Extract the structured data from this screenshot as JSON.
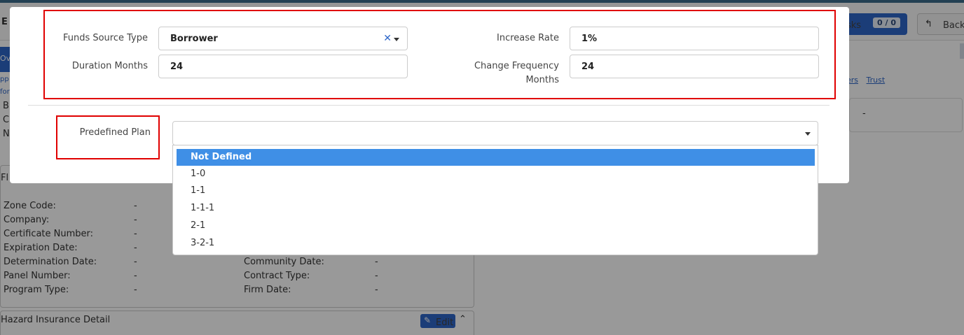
{
  "background": {
    "header_letter": "E",
    "tasks_label": "sks",
    "tasks_count": "0 / 0",
    "back_label": "Back",
    "left_tab_label": "Ov",
    "left_fragment_lines": [
      "B",
      "C",
      "N"
    ],
    "left_link_1": "pp",
    "left_link_2": "for",
    "links": [
      "ers",
      "Trust"
    ],
    "right_card_value": "-",
    "flood_title": "Fl",
    "flood_rows": [
      {
        "k1": "Zone Code:",
        "v1": "-",
        "k2": "",
        "v2": ""
      },
      {
        "k1": "Company:",
        "v1": "-",
        "k2": "",
        "v2": ""
      },
      {
        "k1": "Certificate Number:",
        "v1": "-",
        "k2": "",
        "v2": ""
      },
      {
        "k1": "Expiration Date:",
        "v1": "-",
        "k2": "",
        "v2": ""
      },
      {
        "k1": "Determination Date:",
        "v1": "-",
        "k2": "Community Date:",
        "v2": "-"
      },
      {
        "k1": "Panel Number:",
        "v1": "-",
        "k2": "Contract Type:",
        "v2": "-"
      },
      {
        "k1": "Program Type:",
        "v1": "-",
        "k2": "Firm Date:",
        "v2": "-"
      }
    ],
    "hazard_title": "Hazard Insurance Detail",
    "edit_label": "Edit"
  },
  "modal": {
    "funds_source_type_label": "Funds Source Type",
    "funds_source_type_value": "Borrower",
    "duration_months_label": "Duration Months",
    "duration_months_value": "24",
    "increase_rate_label": "Increase Rate",
    "increase_rate_value": "1%",
    "change_frequency_label_1": "Change Frequency",
    "change_frequency_label_2": "Months",
    "change_frequency_value": "24",
    "predefined_plan_label": "Predefined Plan",
    "predefined_plan_value": "",
    "predefined_plan_options": [
      "Not Defined",
      "1-0",
      "1-1",
      "1-1-1",
      "2-1",
      "3-2-1"
    ],
    "selected_option": "Not Defined"
  },
  "icons": {
    "clear": "close-icon",
    "dropdown": "chevron-down-icon",
    "back": "reply-arrow-icon",
    "edit": "pencil-icon",
    "collapse": "chevron-up-icon"
  },
  "colors": {
    "accent": "#2d66c9",
    "selected_option": "#3f8fe6",
    "highlight_box": "#e00000"
  }
}
